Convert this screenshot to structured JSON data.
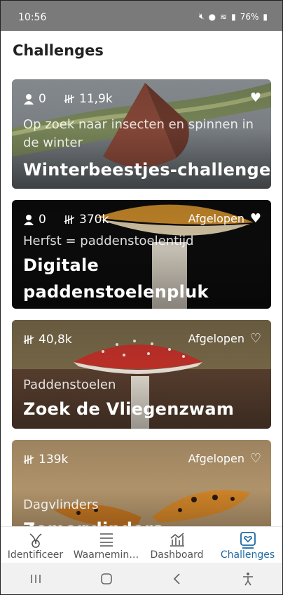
{
  "statusbar": {
    "time": "10:56",
    "battery": "76%"
  },
  "page": {
    "title": "Challenges"
  },
  "cards": [
    {
      "participants": "0",
      "observations": "11,9k",
      "status": "",
      "favorite": true,
      "subtitle": "Op zoek naar insecten en spinnen in de winter",
      "title": "Winterbeestjes-challenge"
    },
    {
      "participants": "0",
      "observations": "370k",
      "status": "Afgelopen",
      "favorite": true,
      "subtitle": "Herfst = paddenstoelentijd",
      "title": "Digitale paddenstoelenpluk"
    },
    {
      "participants": "",
      "observations": "40,8k",
      "status": "Afgelopen",
      "favorite": false,
      "subtitle": "Paddenstoelen",
      "title": "Zoek de Vliegenzwam"
    },
    {
      "participants": "",
      "observations": "139k",
      "status": "Afgelopen",
      "favorite": false,
      "subtitle": "Dagvlinders",
      "title": "Zomervlinders"
    }
  ],
  "nav": [
    {
      "label": "Identificeer",
      "icon": "identify-icon"
    },
    {
      "label": "Waarnemin…",
      "icon": "list-icon"
    },
    {
      "label": "Dashboard",
      "icon": "chart-icon"
    },
    {
      "label": "Challenges",
      "icon": "heart-badge-icon"
    }
  ],
  "colors": {
    "accent": "#1f6aa5",
    "statusbar": "#7a7a7a"
  }
}
